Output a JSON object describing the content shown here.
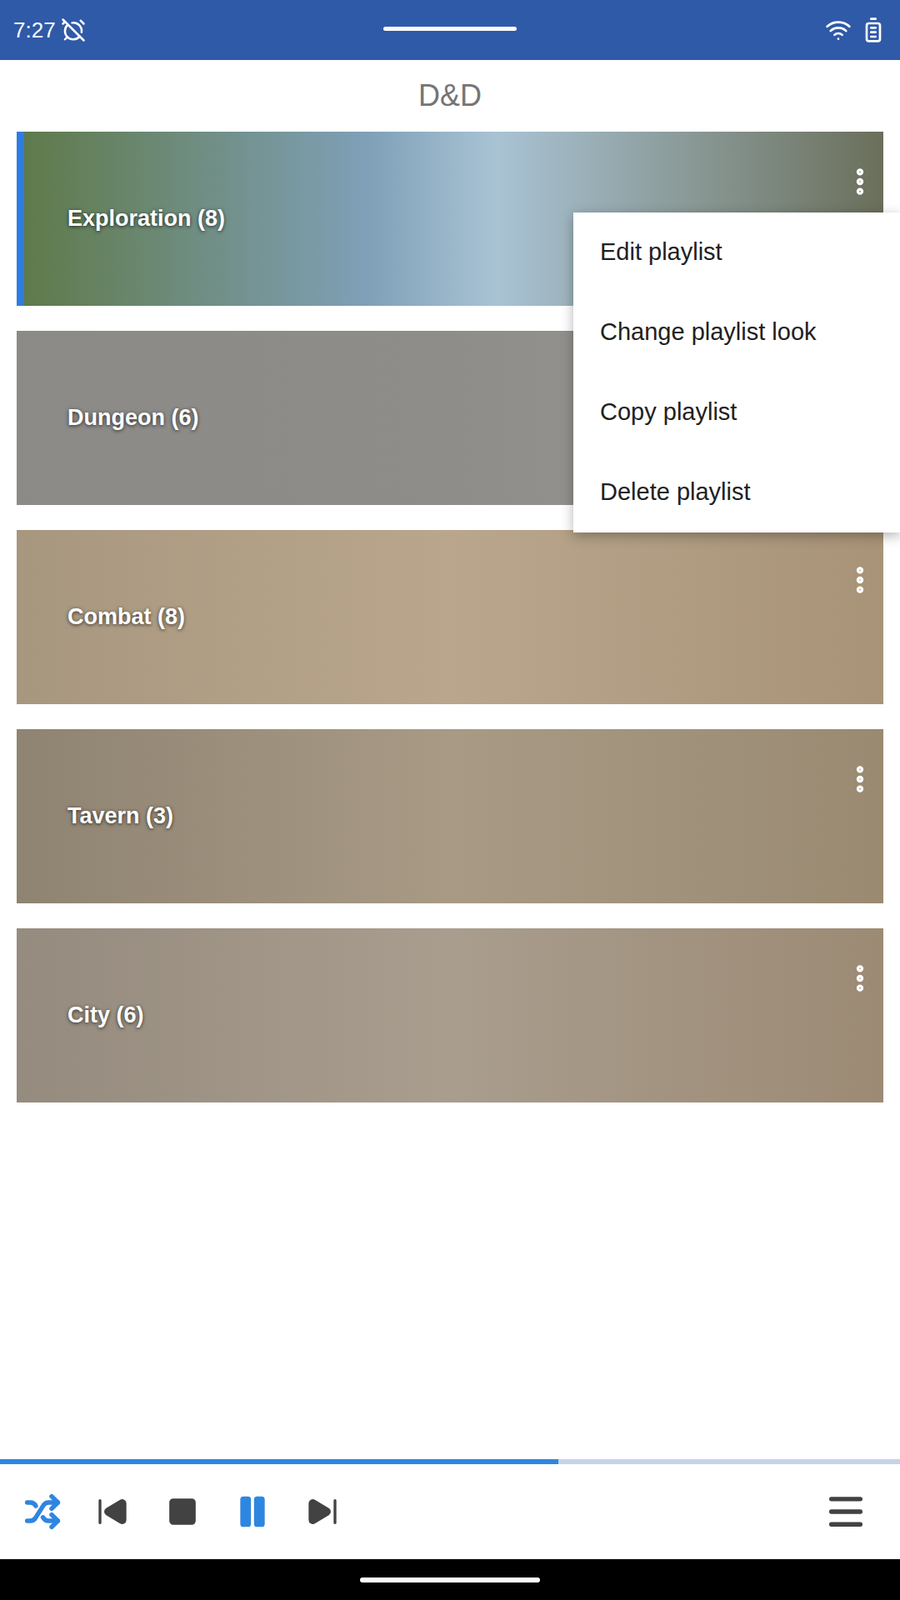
{
  "status_bar": {
    "time": "7:27"
  },
  "header": {
    "title": "D&D"
  },
  "playlists": [
    {
      "label": "Exploration (8)",
      "selected": true
    },
    {
      "label": "Dungeon (6)",
      "selected": false
    },
    {
      "label": "Combat (8)",
      "selected": false
    },
    {
      "label": "Tavern (3)",
      "selected": false
    },
    {
      "label": "City (6)",
      "selected": false
    }
  ],
  "context_menu": {
    "open": true,
    "items": [
      "Edit playlist",
      "Change playlist look",
      "Copy playlist",
      "Delete playlist"
    ]
  },
  "player": {
    "shuffle": true,
    "playing": true,
    "level": 0.62
  }
}
